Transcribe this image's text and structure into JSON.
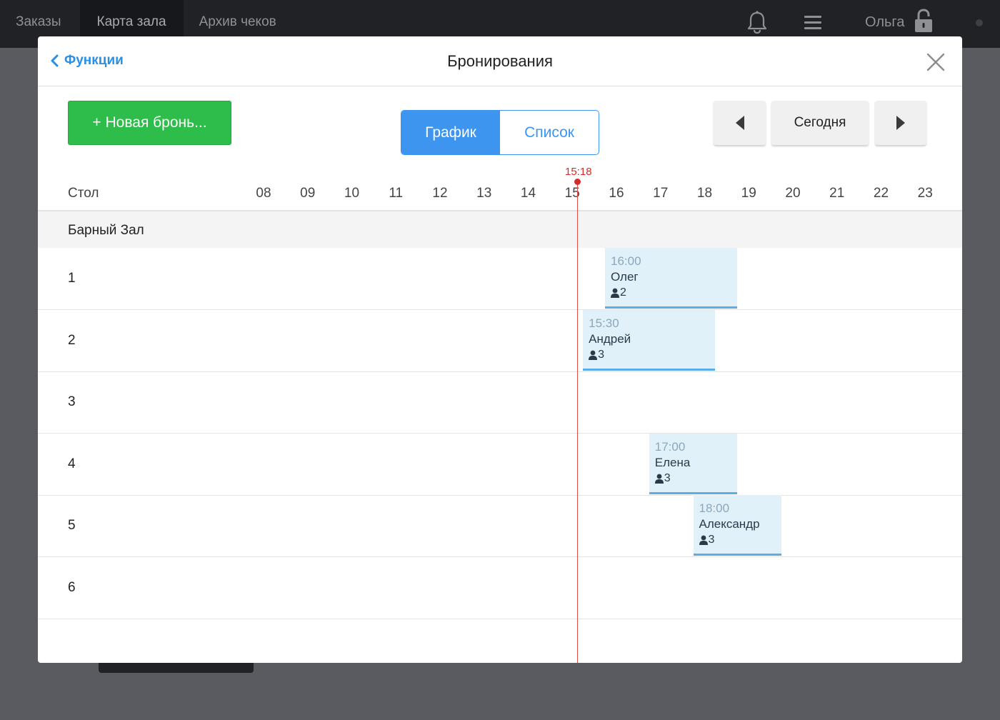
{
  "topbar": {
    "tabs": [
      {
        "label": "Заказы"
      },
      {
        "label": "Карта зала"
      },
      {
        "label": "Архив чеков"
      }
    ],
    "active_tab": "Карта зала",
    "user": "Ольга",
    "icons": [
      "bell-icon",
      "menu-icon",
      "lock-open-icon"
    ]
  },
  "modal": {
    "back_label": "Функции",
    "title": "Бронирования",
    "new_booking_label": "+ Новая бронь...",
    "view_toggle": [
      {
        "label": "График",
        "selected": true
      },
      {
        "label": "Список",
        "selected": false
      }
    ],
    "today_label": "Сегодня"
  },
  "timeline": {
    "column_title": "Стол",
    "hours": [
      "08",
      "09",
      "10",
      "11",
      "12",
      "13",
      "14",
      "15",
      "16",
      "17",
      "18",
      "19",
      "20",
      "21",
      "22",
      "23"
    ],
    "current_time": "15:18",
    "section": "Барный Зал",
    "tables": [
      {
        "label": "1"
      },
      {
        "label": "2"
      },
      {
        "label": "3"
      },
      {
        "label": "4"
      },
      {
        "label": "5"
      },
      {
        "label": "6"
      }
    ],
    "bookings": [
      {
        "table": "1",
        "time": "16:00",
        "name": "Олег",
        "guests": "2",
        "start": 16.0,
        "end": 19.0
      },
      {
        "table": "2",
        "time": "15:30",
        "name": "Андрей",
        "guests": "3",
        "start": 15.5,
        "end": 18.5
      },
      {
        "table": "4",
        "time": "17:00",
        "name": "Елена",
        "guests": "3",
        "start": 17.0,
        "end": 19.0
      },
      {
        "table": "5",
        "time": "18:00",
        "name": "Александр",
        "guests": "3",
        "start": 18.0,
        "end": 20.0
      }
    ]
  },
  "colors": {
    "accent": "#3d95ef",
    "new_button": "#2ebd4a",
    "now_line": "#d62b2b",
    "booking_bg": "#e0f1fa"
  }
}
